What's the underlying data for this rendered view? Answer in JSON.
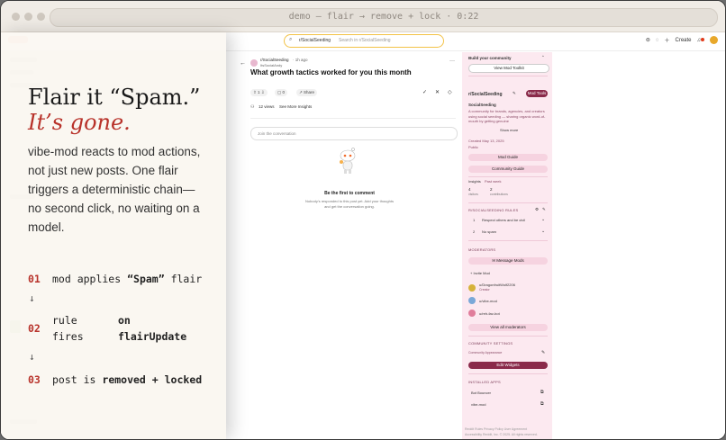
{
  "window": {
    "url_title": "demo — flair → remove + lock · 0:22"
  },
  "topnav": {
    "search_chip": "r/SocialSeeding",
    "search_placeholder": "Search in r/SocialSeeding",
    "create_label": "Create"
  },
  "overlay": {
    "headline": "Flair it “Spam.”",
    "subheadline": "It’s gone.",
    "paragraph": "vibe-mod reacts to mod actions, not just new posts. One flair triggers a deterministic chain—no second click, no waiting on a model.",
    "steps": [
      {
        "num": "01",
        "text_a": "mod applies ",
        "bold": "“Spam”",
        "text_b": " flair"
      },
      {
        "num": "02",
        "text_a": "rule",
        "text_a2": "fires",
        "bold": "on",
        "bold2": "flairUpdate"
      },
      {
        "num": "03",
        "text_a": "post is ",
        "bold": "removed + locked",
        "text_b": ""
      }
    ],
    "arrow": "↓"
  },
  "post": {
    "subreddit": "r/SocialSeeding",
    "age": "· 1h ago",
    "author": "ItsSocialAndy",
    "title": "What growth tactics worked for you this month",
    "votes": "1",
    "comments": "0",
    "share": "Share",
    "views": "12 views",
    "insights": "See More Insights",
    "comment_placeholder": "Join the conversation",
    "first_title": "Be the first to comment",
    "first_sub1": "Nobody's responded to this post yet. Add your thoughts",
    "first_sub2": "and get the conversation going."
  },
  "sidebar": {
    "build_title": "Build your community",
    "view_toolkit": "View Mod Toolkit",
    "sub_name": "r/SocialSeeding",
    "mod_tools": "Mod Tools",
    "display_name": "SocialSeeding",
    "description": "A community for brands, agencies, and creators using social seeding — sharing organic word-of-mouth by getting genuine",
    "show_more": "Show more",
    "created": "Created May 13, 2025",
    "visibility": "Public",
    "mod_guide": "Mod Guide",
    "community_guide": "Community Guide",
    "insights_label": "Insights",
    "insights_range": "Past week",
    "visitors_value": "4",
    "visitors_label": "visitors",
    "contrib_value": "2",
    "contrib_label": "contributions",
    "rules_heading": "R/SOCIALSEEDING RULES",
    "rules": [
      {
        "num": "1",
        "text": "Respect others and be civil"
      },
      {
        "num": "2",
        "text": "No spam"
      }
    ],
    "mods_heading": "MODERATORS",
    "message_mods": "Message Mods",
    "invite_mod": "Invite Mod",
    "mods": [
      {
        "name": "u/DragonfruitWolf2206",
        "role": "Creator",
        "color": "#d6b23a"
      },
      {
        "name": "u/vibe-mod",
        "role": "",
        "color": "#7aa8d8"
      },
      {
        "name": "u/reh-fav-bot",
        "role": "",
        "color": "#e07d9b"
      }
    ],
    "view_all_mods": "View all moderators",
    "settings_heading": "COMMUNITY SETTINGS",
    "appearance": "Community Appearance",
    "edit_widgets": "Edit Widgets",
    "apps_heading": "INSTALLED APPS",
    "apps": [
      "Bot Bouncer",
      "vibe-mod"
    ],
    "footer": "Reddit Rules  Privacy Policy  User Agreement",
    "footer2": "Accessibility  Reddit, Inc. © 2025. All rights reserved."
  },
  "colors": {
    "accent_red": "#b8322a",
    "sidebar_bg": "#fce9f0",
    "mod_button": "#8a2a4a",
    "search_border": "#f3c246"
  }
}
